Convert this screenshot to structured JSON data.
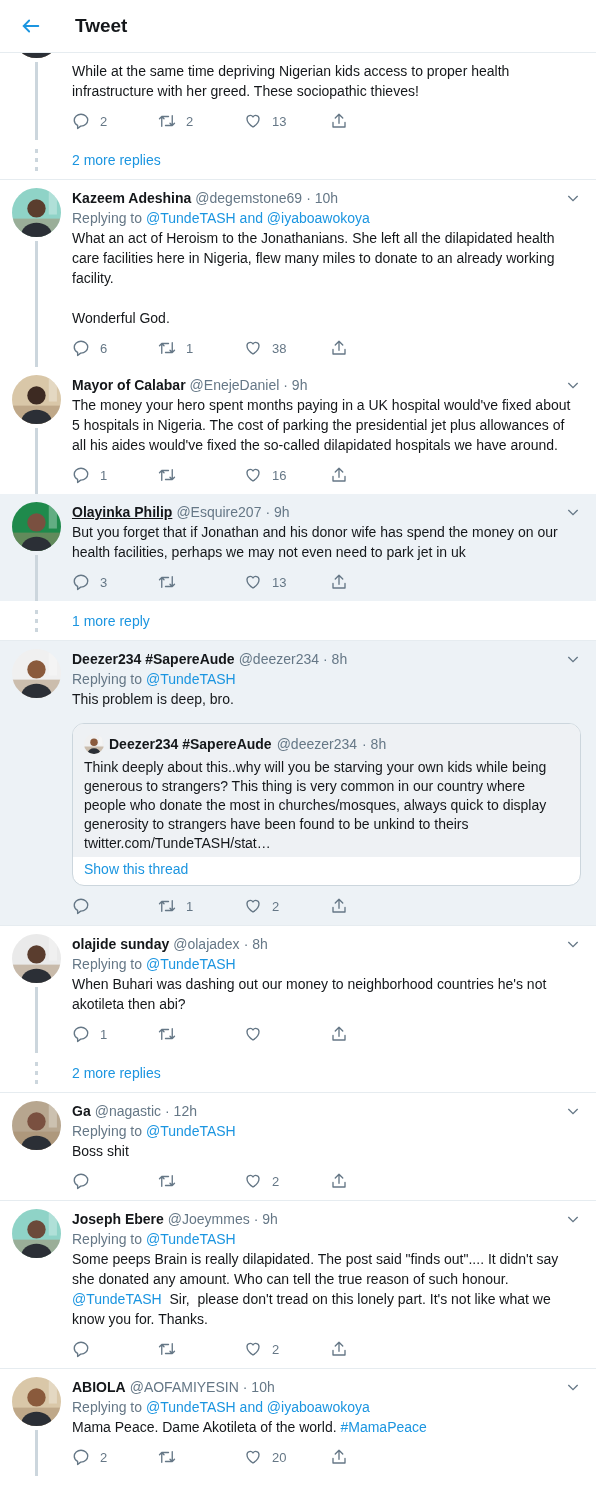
{
  "header": {
    "title": "Tweet"
  },
  "items": [
    {
      "kind": "tweet",
      "highlighted": false,
      "thread_line": true,
      "paragraphs": [
        [
          {
            "text": "While at the same time depriving Nigerian kids access to proper health infrastructure with her greed. These sociopathic thieves!"
          }
        ]
      ],
      "actions": [
        {
          "kind": "reply",
          "count": "2"
        },
        {
          "kind": "retweet",
          "count": "2"
        },
        {
          "kind": "like",
          "count": "13"
        },
        {
          "kind": "share"
        }
      ]
    },
    {
      "kind": "more",
      "label": "2 more replies"
    },
    {
      "kind": "tweet",
      "name": "Kazeem Adeshina",
      "handle": "@degemstone69",
      "time": "· 10h",
      "replying_label": "Replying to",
      "replying_to": "@TundeTASH and @iyaboawokoya",
      "highlighted": false,
      "thread_line": true,
      "paragraphs": [
        [
          {
            "text": "What an act of Heroism to the Jonathanians. She left all the dilapidated health care facilities here in Nigeria, flew many miles to donate to an already working facility."
          }
        ],
        [
          {
            "text": "Wonderful God."
          }
        ]
      ],
      "actions": [
        {
          "kind": "reply",
          "count": "6"
        },
        {
          "kind": "retweet",
          "count": "1"
        },
        {
          "kind": "like",
          "count": "38"
        },
        {
          "kind": "share"
        }
      ]
    },
    {
      "kind": "tweet",
      "name": "Mayor of Calabar",
      "handle": "@EnejeDaniel",
      "time": "· 9h",
      "highlighted": false,
      "thread_line": true,
      "paragraphs": [
        [
          {
            "text": "The money your hero spent months paying in a UK hospital would've fixed about 5 hospitals in Nigeria. The cost of parking the presidential jet plus allowances of all his aides would've fixed the so-called dilapidated hospitals we have around."
          }
        ]
      ],
      "actions": [
        {
          "kind": "reply",
          "count": "1"
        },
        {
          "kind": "retweet"
        },
        {
          "kind": "like",
          "count": "16"
        },
        {
          "kind": "share"
        }
      ]
    },
    {
      "kind": "tweet",
      "name": "Olayinka Philip",
      "handle": "@Esquire207",
      "time": "· 9h",
      "highlighted": true,
      "hovered": true,
      "thread_line": true,
      "paragraphs": [
        [
          {
            "text": "But you forget that if Jonathan and his donor wife has spend the money on our health facilities, perhaps we may not even need to park jet in uk"
          }
        ]
      ],
      "actions": [
        {
          "kind": "reply",
          "count": "3"
        },
        {
          "kind": "retweet"
        },
        {
          "kind": "like",
          "count": "13"
        },
        {
          "kind": "share"
        }
      ]
    },
    {
      "kind": "more",
      "label": "1 more reply"
    },
    {
      "kind": "tweet",
      "name": "Deezer234 #SapereAude",
      "handle": "@deezer234",
      "time": "· 8h",
      "replying_label": "Replying to",
      "replying_to": "@TundeTASH",
      "highlighted": true,
      "thread_line": false,
      "paragraphs": [
        [
          {
            "text": "This problem is deep, bro."
          }
        ]
      ],
      "quote": {
        "name": "Deezer234 #SapereAude",
        "handle": "@deezer234",
        "time": "· 8h",
        "text": "Think deeply about this..why will you be starving your own kids while being generous to strangers? This thing is very common in our country where people who donate the most in churches/mosques, always quick to display generosity to strangers have been found to be unkind to theirs twitter.com/TundeTASH/stat…",
        "link": "Show this thread"
      },
      "actions": [
        {
          "kind": "reply"
        },
        {
          "kind": "retweet",
          "count": "1"
        },
        {
          "kind": "like",
          "count": "2"
        },
        {
          "kind": "share"
        }
      ]
    },
    {
      "kind": "tweet",
      "name": "olajide sunday",
      "handle": "@olajadex",
      "time": "· 8h",
      "replying_label": "Replying to",
      "replying_to": "@TundeTASH",
      "highlighted": false,
      "thread_line": true,
      "paragraphs": [
        [
          {
            "text": "When Buhari was dashing out our money to neighborhood countries he's not akotileta then abi?"
          }
        ]
      ],
      "actions": [
        {
          "kind": "reply",
          "count": "1"
        },
        {
          "kind": "retweet"
        },
        {
          "kind": "like"
        },
        {
          "kind": "share"
        }
      ]
    },
    {
      "kind": "more",
      "label": "2 more replies"
    },
    {
      "kind": "tweet",
      "name": "Ga",
      "handle": "@nagastic",
      "time": "· 12h",
      "replying_label": "Replying to",
      "replying_to": "@TundeTASH",
      "highlighted": false,
      "thread_line": false,
      "paragraphs": [
        [
          {
            "text": "Boss shit"
          }
        ]
      ],
      "actions": [
        {
          "kind": "reply"
        },
        {
          "kind": "retweet"
        },
        {
          "kind": "like",
          "count": "2"
        },
        {
          "kind": "share"
        }
      ]
    },
    {
      "kind": "tweet",
      "name": "Joseph Ebere",
      "handle": "@Joeymmes",
      "time": "· 9h",
      "replying_label": "Replying to",
      "replying_to": "@TundeTASH",
      "highlighted": false,
      "thread_line": false,
      "paragraphs": [
        [
          {
            "text": "Some peeps Brain is really dilapidated. The post said \"finds out\".... It didn't say she donated any amount. Who can tell the true reason of such honour. "
          },
          {
            "text": "@TundeTASH",
            "link": true
          },
          {
            "text": "  Sir,  please don't tread on this lonely part. It's not like what we know you for. Thanks."
          }
        ]
      ],
      "actions": [
        {
          "kind": "reply"
        },
        {
          "kind": "retweet"
        },
        {
          "kind": "like",
          "count": "2"
        },
        {
          "kind": "share"
        }
      ]
    },
    {
      "kind": "tweet",
      "name": "ABIOLA",
      "handle": "@AOFAMIYESIN",
      "time": "· 10h",
      "replying_label": "Replying to",
      "replying_to": "@TundeTASH and @iyaboawokoya",
      "highlighted": false,
      "thread_line": true,
      "paragraphs": [
        [
          {
            "text": "Mama Peace. Dame Akotileta of the world. "
          },
          {
            "text": "#MamaPeace",
            "link": true
          }
        ]
      ],
      "actions": [
        {
          "kind": "reply",
          "count": "2"
        },
        {
          "kind": "retweet"
        },
        {
          "kind": "like",
          "count": "20"
        },
        {
          "kind": "share"
        }
      ]
    }
  ]
}
